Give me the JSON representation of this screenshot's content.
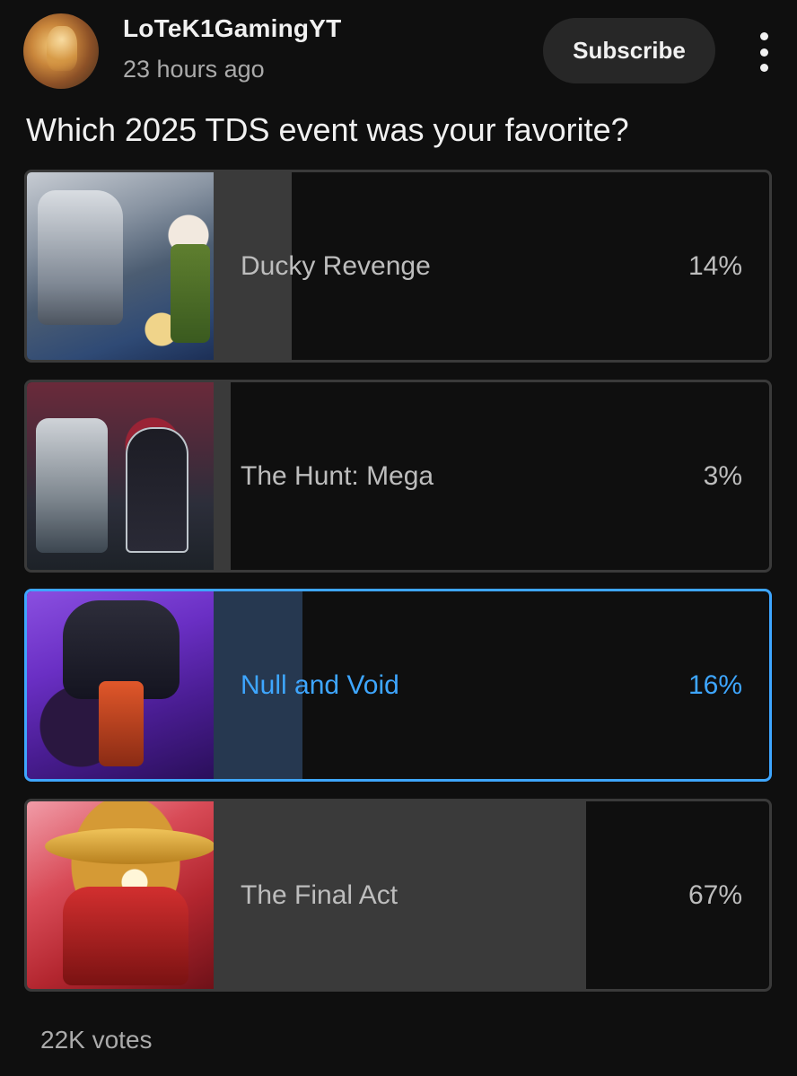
{
  "post": {
    "channel_name": "LoTeK1GamingYT",
    "time_ago": "23 hours ago",
    "subscribe_label": "Subscribe",
    "question": "Which 2025 TDS event was your favorite?",
    "votes_label": "22K votes"
  },
  "poll": {
    "options": [
      {
        "label": "Ducky Revenge",
        "percent_label": "14%",
        "percent": 14,
        "selected": false
      },
      {
        "label": "The Hunt: Mega",
        "percent_label": "3%",
        "percent": 3,
        "selected": false
      },
      {
        "label": "Null and Void",
        "percent_label": "16%",
        "percent": 16,
        "selected": true
      },
      {
        "label": "The Final Act",
        "percent_label": "67%",
        "percent": 67,
        "selected": false
      }
    ]
  },
  "icons": {
    "more": "more-vertical-icon"
  },
  "colors": {
    "background": "#0f0f0f",
    "selected_accent": "#3ea6ff",
    "bar_fill": "#3a3a3a",
    "selected_bar_fill": "#263850"
  }
}
